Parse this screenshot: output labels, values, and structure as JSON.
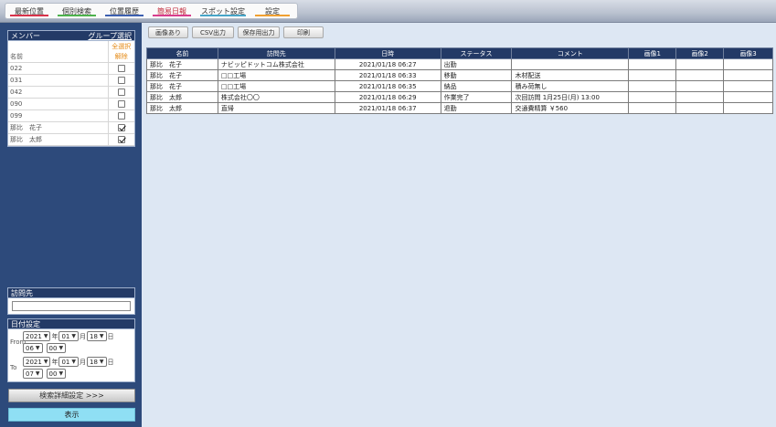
{
  "nav": {
    "tabs": [
      {
        "label": "最新位置",
        "underline": "#d8324a"
      },
      {
        "label": "個別検索",
        "underline": "#4cb24c"
      },
      {
        "label": "位置履歴",
        "underline": "#3c5fb0"
      },
      {
        "label": "簡易日報",
        "underline": "#d83c8c"
      },
      {
        "label": "スポット設定",
        "underline": "#46a5c8"
      },
      {
        "label": "設定",
        "underline": "#f0a030"
      }
    ],
    "active_index": 3
  },
  "members": {
    "title": "メンバー",
    "group_select": "グループ選択",
    "name_header": "名前",
    "select_all": "全選択",
    "clear": "解除",
    "rows": [
      {
        "name": "022",
        "checked": false
      },
      {
        "name": "031",
        "checked": false
      },
      {
        "name": "042",
        "checked": false
      },
      {
        "name": "090",
        "checked": false
      },
      {
        "name": "099",
        "checked": false
      },
      {
        "name": "那比　花子",
        "checked": true
      },
      {
        "name": "那比　太郎",
        "checked": true
      }
    ]
  },
  "visit": {
    "title": "訪問先",
    "value": ""
  },
  "date": {
    "title": "日付設定",
    "from": {
      "label": "From",
      "year": "2021",
      "month": "01",
      "day": "18",
      "hour": "06",
      "minute": "00"
    },
    "to": {
      "label": "To",
      "year": "2021",
      "month": "01",
      "day": "18",
      "hour": "07",
      "minute": "00"
    },
    "unit_year": "年",
    "unit_month": "月",
    "unit_day": "日"
  },
  "buttons": {
    "detail": "検索詳細設定 >>>",
    "show": "表示"
  },
  "toolbar": [
    "画像あり",
    "CSV出力",
    "保存用出力",
    "印刷"
  ],
  "table": {
    "headers": [
      "名前",
      "訪問先",
      "日時",
      "ステータス",
      "コメント",
      "画像1",
      "画像2",
      "画像3"
    ],
    "rows": [
      [
        "那比　花子",
        "ナビッピドットコム株式会社",
        "2021/01/18 06:27",
        "出勤",
        "",
        "",
        "",
        ""
      ],
      [
        "那比　花子",
        "□□工場",
        "2021/01/18 06:33",
        "移動",
        "木材配送",
        "",
        "",
        ""
      ],
      [
        "那比　花子",
        "□□工場",
        "2021/01/18 06:35",
        "納品",
        "積み荷無し",
        "",
        "",
        ""
      ],
      [
        "那比　太郎",
        "株式会社〇〇",
        "2021/01/18 06:29",
        "作業完了",
        "次回訪問 1月25日(月) 13:00",
        "",
        "",
        ""
      ],
      [
        "那比　太郎",
        "直帰",
        "2021/01/18 06:37",
        "退勤",
        "交通費精算 ￥560",
        "",
        "",
        ""
      ]
    ]
  }
}
